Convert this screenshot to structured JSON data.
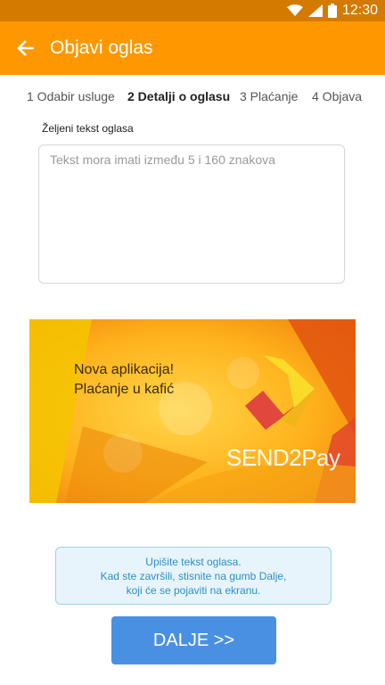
{
  "status_bar": {
    "time": "12:30"
  },
  "app_bar": {
    "title": "Objavi oglas"
  },
  "steps": [
    {
      "label": "1 Odabir usluge"
    },
    {
      "label": "2 Detalji o oglasu"
    },
    {
      "label": "3 Plaćanje"
    },
    {
      "label": "4 Objava"
    }
  ],
  "form": {
    "label": "Željeni tekst oglasa",
    "placeholder": "Tekst mora imati između 5 i 160 znakova"
  },
  "banner": {
    "headline_1": "Nova aplikacija!",
    "headline_2": "Plaćanje u kafić",
    "brand": "SEND2Pay"
  },
  "info": {
    "line_1": "Upišite tekst oglasa.",
    "line_2": "Kad ste završili, stisnite na gumb Dalje,",
    "line_3": "koji će se pojaviti na ekranu."
  },
  "next_button": {
    "label": "DALJE >>"
  }
}
